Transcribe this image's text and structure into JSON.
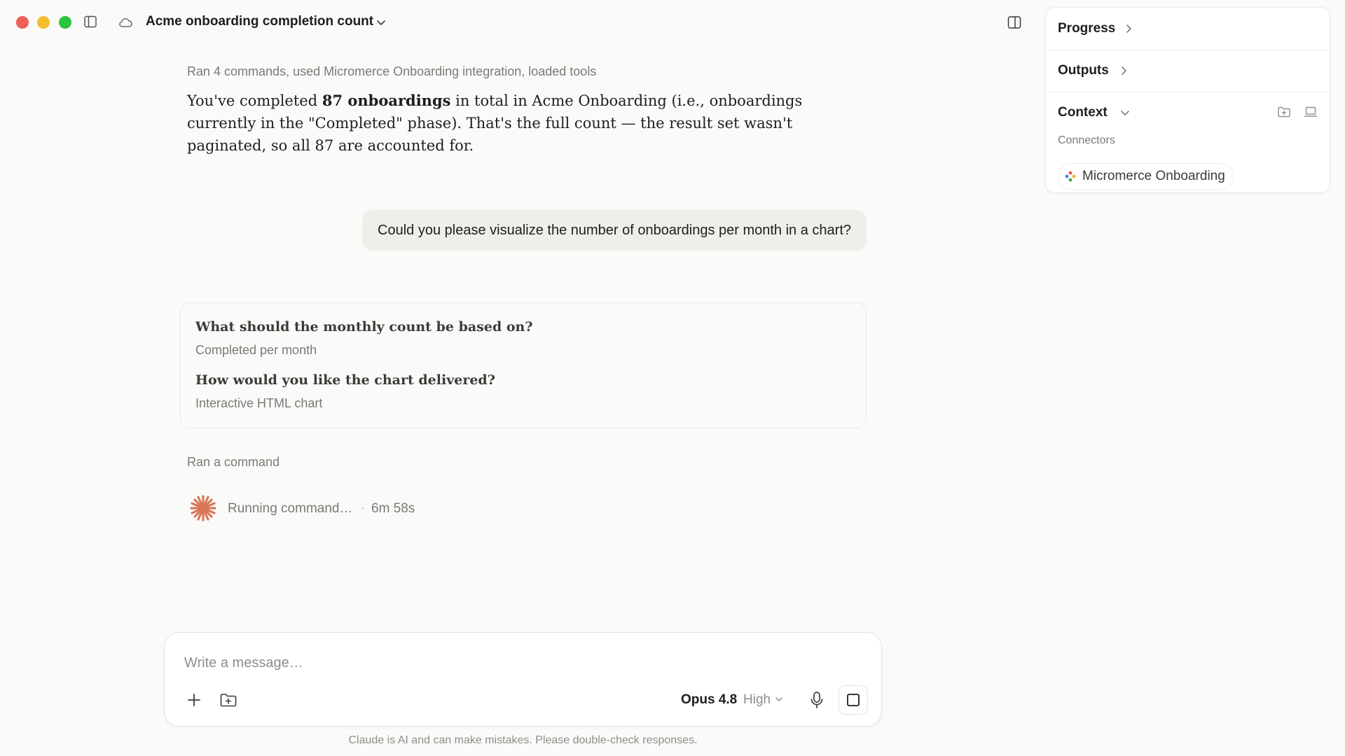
{
  "window": {
    "title": "Acme onboarding completion count"
  },
  "conversation": {
    "tools_summary": "Ran 4 commands, used Micromerce Onboarding integration, loaded tools",
    "answer": {
      "part1": "You've completed ",
      "bold": "87 onboardings",
      "part2": " in total in Acme Onboarding (i.e., onboardings currently in the \"Completed\" phase). That's the full count — the result set wasn't paginated, so all 87 are accounted for."
    },
    "user_message": "Could you please visualize the number of onboardings per month in a chart?",
    "qa": [
      {
        "question": "What should the monthly count be based on?",
        "answer": "Completed per month"
      },
      {
        "question": "How would you like the chart delivered?",
        "answer": "Interactive HTML chart"
      }
    ],
    "command_label": "Ran a command",
    "running_status": "Running command…",
    "elapsed": "6m 58s"
  },
  "composer": {
    "placeholder": "Write a message…",
    "model": "Opus 4.8",
    "effort": "High"
  },
  "disclaimer": "Claude is AI and can make mistakes. Please double-check responses.",
  "side_panel": {
    "progress_label": "Progress",
    "outputs_label": "Outputs",
    "context_label": "Context",
    "connectors_label": "Connectors",
    "connector_name": "Micromerce Onboarding"
  },
  "colors": {
    "accent": "#d97757",
    "traffic_red": "#ee5f57",
    "traffic_yellow": "#f6bd2f",
    "traffic_green": "#29c440"
  },
  "icons": [
    "sidebar-toggle-icon",
    "cloud-icon",
    "chevron-down-icon",
    "panel-toggle-icon",
    "spark-icon",
    "plus-icon",
    "folder-add-icon",
    "microphone-icon",
    "stop-icon",
    "chevron-right-icon",
    "folder-icon",
    "laptop-icon",
    "connector-icon"
  ]
}
